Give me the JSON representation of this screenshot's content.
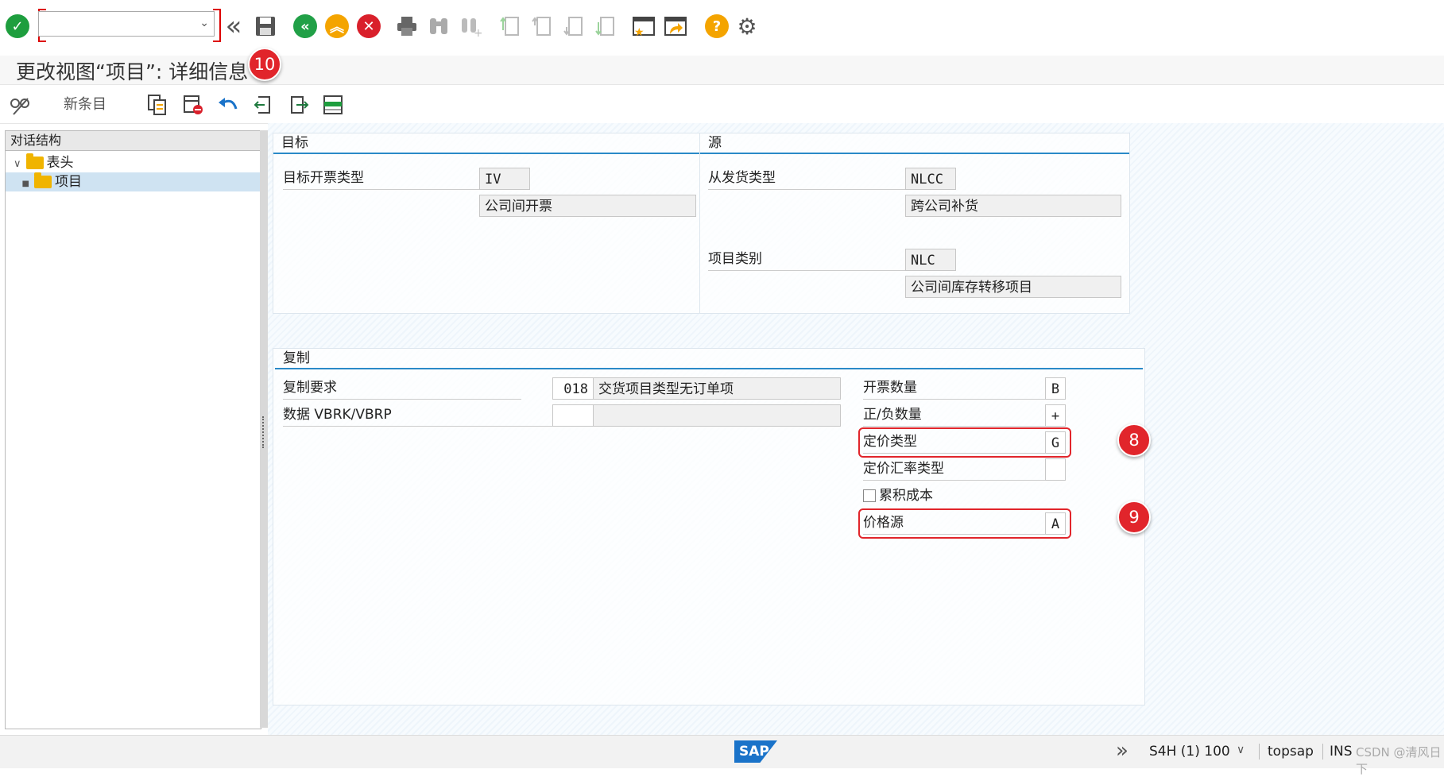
{
  "toolbar": {
    "command_value": "",
    "dropdown_glyph": "⌄",
    "double_left": "«",
    "help": "?"
  },
  "title": {
    "text": "更改视图“项目”: 详细信息"
  },
  "badges": {
    "b10": "10",
    "b8": "8",
    "b9": "9"
  },
  "app_toolbar": {
    "new_entries": "新条目"
  },
  "tree": {
    "header": "对话结构",
    "items": [
      {
        "label": "表头"
      },
      {
        "label": "项目"
      }
    ]
  },
  "target": {
    "title": "目标",
    "billing_type_label": "目标开票类型",
    "billing_type_value": "IV",
    "billing_type_desc": "公司间开票"
  },
  "source": {
    "title": "源",
    "delivery_type_label": "从发货类型",
    "delivery_type_value": "NLCC",
    "delivery_type_desc": "跨公司补货",
    "item_cat_label": "项目类别",
    "item_cat_value": "NLC",
    "item_cat_desc": "公司间库存转移项目"
  },
  "copy": {
    "title": "复制",
    "req_label": "复制要求",
    "req_value": "018",
    "req_desc": "交货项目类型无订单项",
    "data_label": "数据 VBRK/VBRP",
    "data_value": "",
    "billing_qty_label": "开票数量",
    "billing_qty_value": "B",
    "sign_label": "正/负数量",
    "sign_value": "+",
    "pricing_type_label": "定价类型",
    "pricing_type_value": "G",
    "exrate_label": "定价汇率类型",
    "exrate_value": "",
    "cumulate_label": "累积成本",
    "price_source_label": "价格源",
    "price_source_value": "A"
  },
  "status": {
    "expand": "»",
    "system": "S4H (1) 100",
    "user": "topsap",
    "mode": "INS",
    "sap": "SAP",
    "watermark": "CSDN @清风日下"
  },
  "colors": {
    "accent": "#2a8ac8",
    "badge": "#e1252b",
    "ok_green": "#1e9e3e",
    "nav_green": "#21a047",
    "nav_yellow": "#f4a400",
    "cancel_red": "#d9202b"
  }
}
